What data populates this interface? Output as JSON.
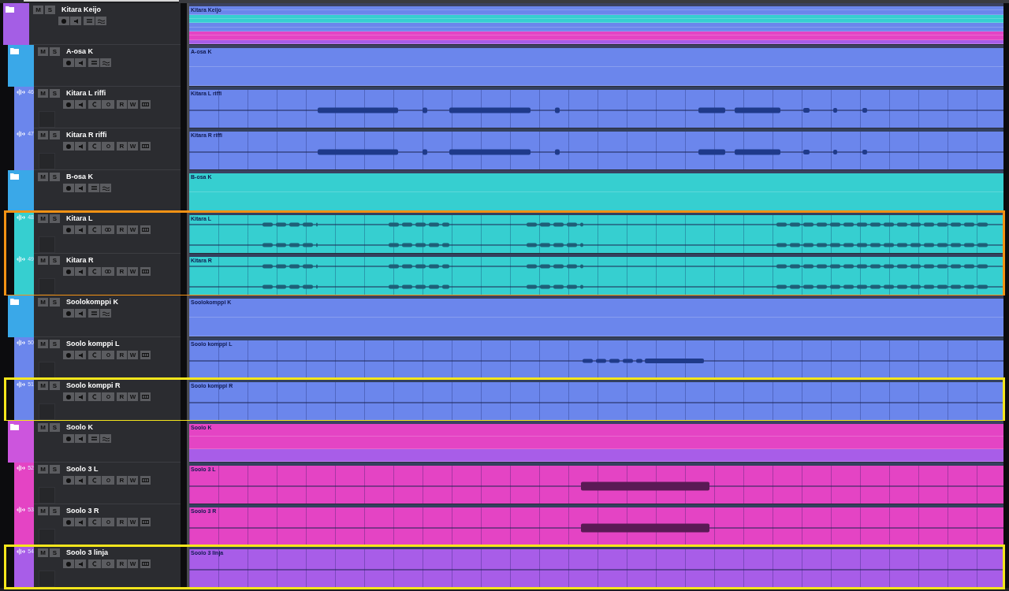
{
  "tracks": [
    {
      "kind": "folder",
      "name": "Kitara Keijo",
      "color": "#a45ee5",
      "mute": "M",
      "solo": "S",
      "clip": "Kitara Keijo",
      "children": [
        {
          "kind": "folder",
          "name": "A-osa K",
          "color": "#3aa8e8",
          "mute": "M",
          "solo": "S",
          "clip": "A-osa K",
          "children": [
            {
              "kind": "audio",
              "number": "46",
              "name": "Kitara L riffi",
              "color": "#6b86ec",
              "mute": "M",
              "solo": "S",
              "read": "R",
              "write": "W",
              "lanes_active": false,
              "clip": "Kitara L riffi",
              "waveform": {
                "kind": "riff"
              }
            },
            {
              "kind": "audio",
              "number": "47",
              "name": "Kitara R riffi",
              "color": "#6b86ec",
              "mute": "M",
              "solo": "S",
              "read": "R",
              "write": "W",
              "lanes_active": false,
              "clip": "Kitara R riffi",
              "waveform": {
                "kind": "riff"
              }
            }
          ]
        },
        {
          "kind": "folder",
          "name": "B-osa K",
          "color": "#3aa8e8",
          "mute": "M",
          "solo": "S",
          "clip": "B-osa K",
          "children": [
            {
              "kind": "audio",
              "number": "48",
              "name": "Kitara L",
              "color": "#36cfd0",
              "mute": "M",
              "solo": "S",
              "read": "R",
              "write": "W",
              "lanes_active": true,
              "clip": "Kitara L",
              "waveform": {
                "kind": "rhythm"
              },
              "frame": {
                "color": "#f39214"
              }
            },
            {
              "kind": "audio",
              "number": "49",
              "name": "Kitara R",
              "color": "#36cfd0",
              "mute": "M",
              "solo": "S",
              "read": "R",
              "write": "W",
              "lanes_active": true,
              "clip": "Kitara R",
              "waveform": {
                "kind": "rhythm"
              },
              "frame": {
                "color": "#f39214"
              }
            }
          ]
        },
        {
          "kind": "folder",
          "name": "Soolokomppi K",
          "color": "#3aa8e8",
          "mute": "M",
          "solo": "S",
          "clip": "Soolokomppi K",
          "children": [
            {
              "kind": "audio",
              "number": "50",
              "name": "Soolo komppi L",
              "color": "#6b86ec",
              "mute": "M",
              "solo": "S",
              "read": "R",
              "write": "W",
              "lanes_active": false,
              "clip": "Soolo komppi L",
              "waveform": {
                "kind": "phrase"
              }
            },
            {
              "kind": "audio",
              "number": "51",
              "name": "Soolo komppi R",
              "color": "#6b86ec",
              "mute": "M",
              "solo": "S",
              "read": "R",
              "write": "W",
              "lanes_active": false,
              "clip": "Soolo komppi R",
              "waveform": {
                "kind": "flat"
              },
              "frame": {
                "color": "#f5e61c"
              }
            }
          ]
        },
        {
          "kind": "folder",
          "name": "Soolo K",
          "color": "#cc55dd",
          "mute": "M",
          "solo": "S",
          "clip": "Soolo K",
          "children": [
            {
              "kind": "audio",
              "number": "52",
              "name": "Soolo 3 L",
              "color": "#e444c4",
              "mute": "M",
              "solo": "S",
              "read": "R",
              "write": "W",
              "lanes_active": false,
              "clip": "Soolo 3 L",
              "waveform": {
                "kind": "lead"
              }
            },
            {
              "kind": "audio",
              "number": "53",
              "name": "Soolo 3 R",
              "color": "#e444c4",
              "mute": "M",
              "solo": "S",
              "read": "R",
              "write": "W",
              "lanes_active": false,
              "clip": "Soolo 3 R",
              "waveform": {
                "kind": "lead"
              }
            },
            {
              "kind": "audio",
              "number": "54",
              "name": "Soolo 3 linja",
              "color": "#a85de8",
              "mute": "M",
              "solo": "S",
              "read": "R",
              "write": "W",
              "lanes_active": false,
              "clip": "Soolo 3 linja",
              "waveform": {
                "kind": "flat"
              },
              "frame": {
                "color": "#f5e61c"
              }
            }
          ]
        }
      ]
    }
  ]
}
